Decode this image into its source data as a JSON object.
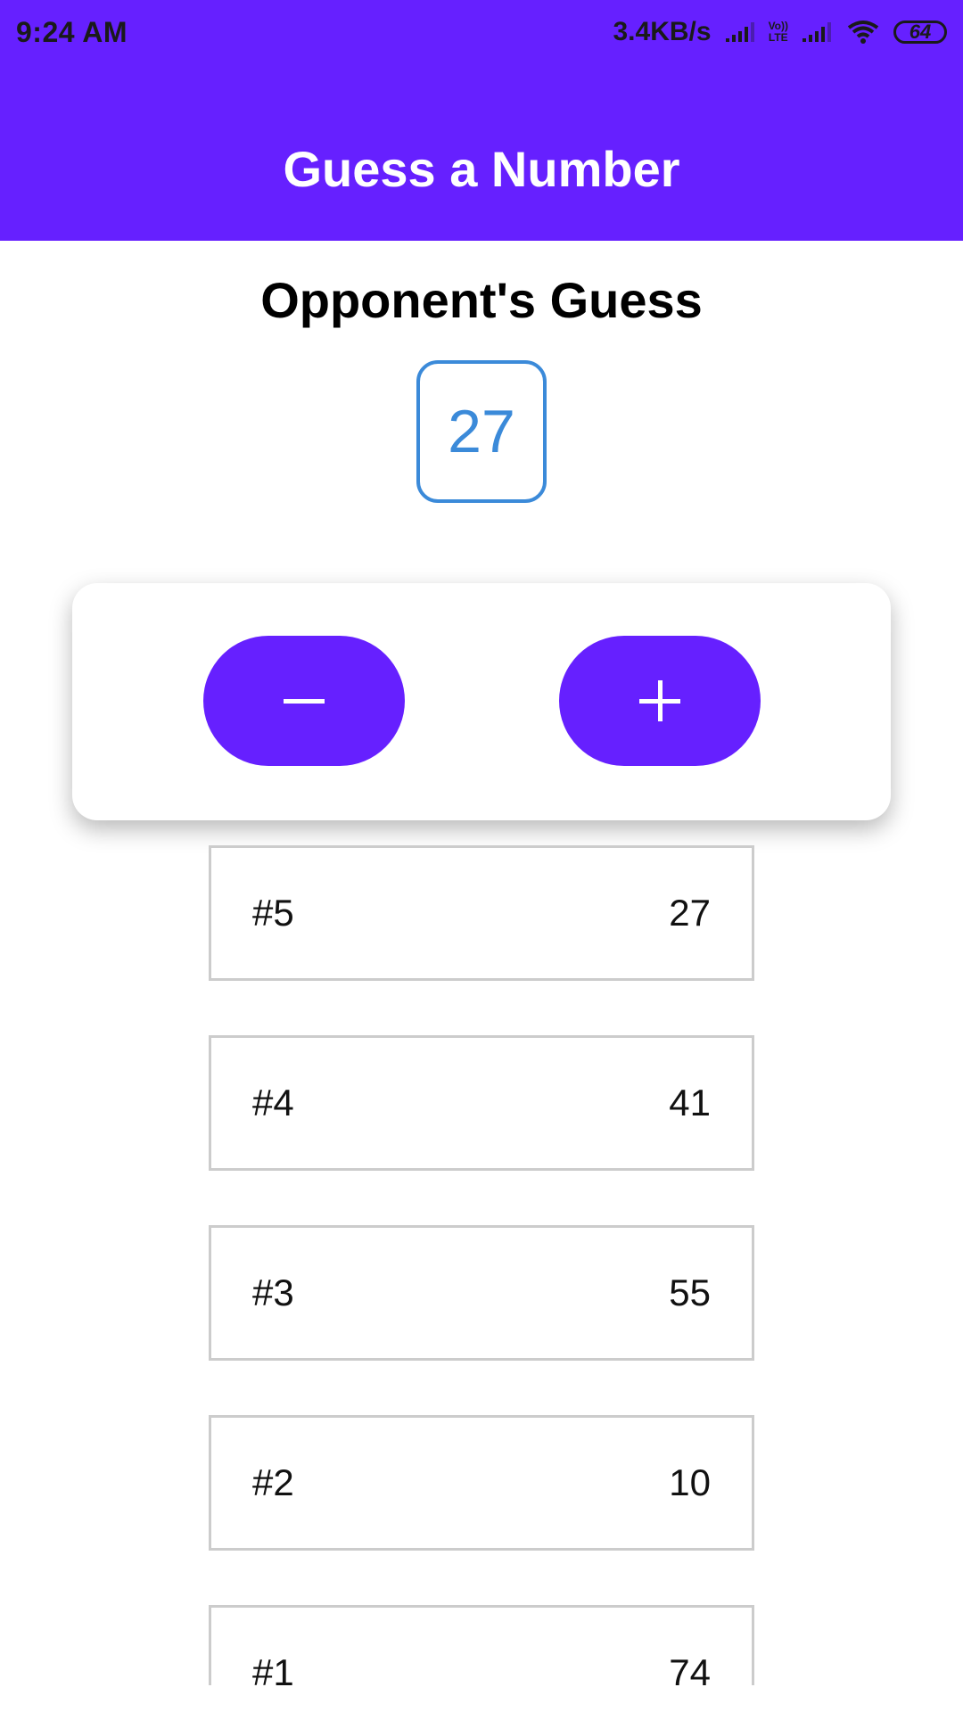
{
  "status_bar": {
    "time": "9:24 AM",
    "net_speed": "3.4KB/s",
    "volte_top": "Vo))",
    "volte_bottom": "LTE",
    "battery": "64"
  },
  "header": {
    "title": "Guess a Number",
    "bg_color": "#6620ff"
  },
  "main": {
    "section_title": "Opponent's Guess",
    "current_guess": "27",
    "buttons": {
      "lower_icon": "minus-icon",
      "higher_icon": "plus-icon"
    }
  },
  "guesses": [
    {
      "round": "#5",
      "value": "27"
    },
    {
      "round": "#4",
      "value": "41"
    },
    {
      "round": "#3",
      "value": "55"
    },
    {
      "round": "#2",
      "value": "10"
    },
    {
      "round": "#1",
      "value": "74"
    }
  ],
  "colors": {
    "accent": "#6620ff",
    "guess_border": "#3b8ad9"
  }
}
